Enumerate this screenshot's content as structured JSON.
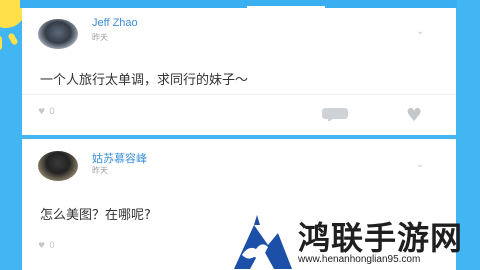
{
  "feed": {
    "posts": [
      {
        "author": "Jeff Zhao",
        "time": "昨天",
        "content": "一个人旅行太单调，求同行的妹子～",
        "likes": "0"
      },
      {
        "author": "姑苏慕容峰",
        "time": "昨天",
        "content": "怎么美图？在哪呢?",
        "likes": "0"
      }
    ]
  },
  "icons": {
    "expand": "chevron-down-icon",
    "like": "heart-icon",
    "comment": "comment-icon"
  },
  "watermark": {
    "title": "鸿联手游网",
    "url": "www.henanhonglian95.com"
  },
  "colors": {
    "background": "#41b6f2",
    "author": "#3b8fd9",
    "sun": "#ffe04a"
  }
}
